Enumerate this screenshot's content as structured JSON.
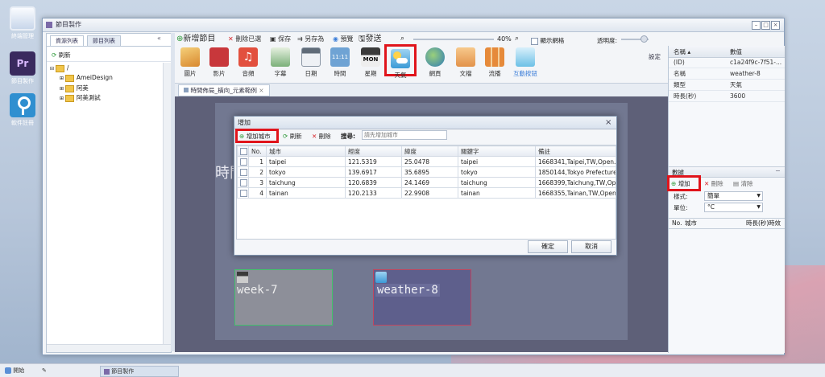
{
  "desktop": {
    "icons": [
      {
        "label": "終端管理"
      },
      {
        "label": "節目製作",
        "glyph": "Pr"
      },
      {
        "label": "軟件註冊"
      }
    ]
  },
  "taskbar": {
    "start_label": "開始",
    "task_label": "節目製作"
  },
  "window": {
    "title": "節目製作"
  },
  "left_panel": {
    "tabs": [
      "資源列表",
      "節目列表"
    ],
    "refresh_label": "刷新",
    "tree": {
      "root": "/",
      "items": [
        "AmeiDesign",
        "阿美",
        "阿美測試"
      ]
    }
  },
  "toolbar": {
    "new_program": "新增節目",
    "delete_selected": "刪除已選",
    "save": "保存",
    "save_as": "另存為",
    "preview": "預覽",
    "publish": "發送",
    "zoom": "40%",
    "show_grid": "顯示網格",
    "transparency": "透明度:",
    "settings": "設定",
    "icons": [
      "圖片",
      "影片",
      "音頻",
      "字幕",
      "日期",
      "時間",
      "星期",
      "天氣",
      "網頁",
      "文檔",
      "流播",
      "互動按鈕"
    ],
    "clock_glyph": "11:11",
    "weekday_glyph": "MON"
  },
  "doc_tab": {
    "label": "時間佈局_橫向_元素範例"
  },
  "canvas": {
    "bg_text": "時間",
    "elements": [
      {
        "label": "week-7"
      },
      {
        "label": "weather-8"
      }
    ]
  },
  "properties": {
    "header_name": "名稱",
    "header_value": "數值",
    "rows": [
      {
        "name": "(ID)",
        "value": "c1a24f9c-7f51-..."
      },
      {
        "name": "名稱",
        "value": "weather-8"
      },
      {
        "name": "類型",
        "value": "天氣"
      },
      {
        "name": "時長(秒)",
        "value": "3600"
      }
    ]
  },
  "city_panel": {
    "title": "數據",
    "add": "增加",
    "delete": "刪除",
    "clear": "清除",
    "mode_label": "樣式:",
    "mode_value": "簡單",
    "unit_label": "單位:",
    "unit_value": "°C",
    "columns": [
      "No.",
      "城市",
      "時長(秒)",
      "時效"
    ]
  },
  "dialog": {
    "title": "增加",
    "add_city": "增加城市",
    "refresh": "刷新",
    "delete": "刪除",
    "search_label": "搜尋:",
    "search_placeholder": "請先增加城市",
    "columns": [
      "No.",
      "城市",
      "經度",
      "緯度",
      "關鍵字",
      "備註"
    ],
    "rows": [
      {
        "no": "1",
        "city": "taipei",
        "lng": "121.5319",
        "lat": "25.0478",
        "kw": "taipei",
        "note": "1668341,Taipei,TW,Open..."
      },
      {
        "no": "2",
        "city": "tokyo",
        "lng": "139.6917",
        "lat": "35.6895",
        "kw": "tokyo",
        "note": "1850144,Tokyo Prefecture..."
      },
      {
        "no": "3",
        "city": "taichung",
        "lng": "120.6839",
        "lat": "24.1469",
        "kw": "taichung",
        "note": "1668399,Taichung,TW,Open..."
      },
      {
        "no": "4",
        "city": "tainan",
        "lng": "120.2133",
        "lat": "22.9908",
        "kw": "tainan",
        "note": "1668355,Tainan,TW,Open..."
      }
    ],
    "ok": "確定",
    "cancel": "取消"
  },
  "colors": {
    "highlight": "#e0141b",
    "canvas_bg": "#5e6078",
    "accent_blue": "#3b7dd8"
  }
}
